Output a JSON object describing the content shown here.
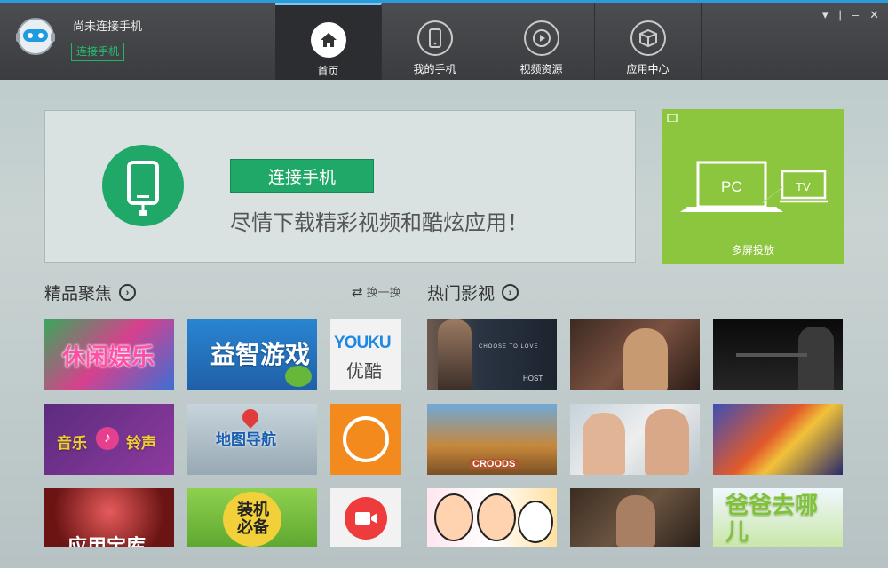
{
  "header": {
    "device_status": "尚未连接手机",
    "connect_link": "连接手机",
    "nav": [
      {
        "label": "首页",
        "icon": "home-icon",
        "active": true
      },
      {
        "label": "我的手机",
        "icon": "phone-icon",
        "active": false
      },
      {
        "label": "视频资源",
        "icon": "play-icon",
        "active": false
      },
      {
        "label": "应用中心",
        "icon": "box-icon",
        "active": false
      }
    ],
    "window_controls": [
      "▾",
      "|",
      "–",
      "✕"
    ]
  },
  "banner": {
    "connect_button": "连接手机",
    "slogan": "尽情下载精彩视频和酷炫应用！"
  },
  "multiscreen": {
    "label": "多屏投放",
    "pc": "PC",
    "tv": "TV"
  },
  "featured": {
    "title": "精品聚焦",
    "refresh": "换一换",
    "tiles": [
      {
        "text": "休闲娱乐"
      },
      {
        "text": "益智游戏"
      },
      {
        "text": "YOUKU",
        "sub": "优酷"
      },
      {
        "text": "音乐",
        "sub": "铃声"
      },
      {
        "text": "地图导航"
      },
      {
        "text": ""
      },
      {
        "text": "应用宝库"
      },
      {
        "text": "装机必备"
      },
      {
        "text": ""
      }
    ]
  },
  "hot_videos": {
    "title": "热门影视",
    "tiles": [
      {
        "text": "CHOOSE TO LOVE",
        "sub": "HOST"
      },
      {
        "text": ""
      },
      {
        "text": ""
      },
      {
        "text": "CROODS"
      },
      {
        "text": ""
      },
      {
        "text": ""
      },
      {
        "text": ""
      },
      {
        "text": ""
      },
      {
        "text": "爸爸去哪儿"
      }
    ]
  },
  "colors": {
    "accent_green": "#1fa868",
    "multiscreen_green": "#8cc53e",
    "topbar": "#3e4043",
    "tab_active_border": "#7fc6ef"
  }
}
